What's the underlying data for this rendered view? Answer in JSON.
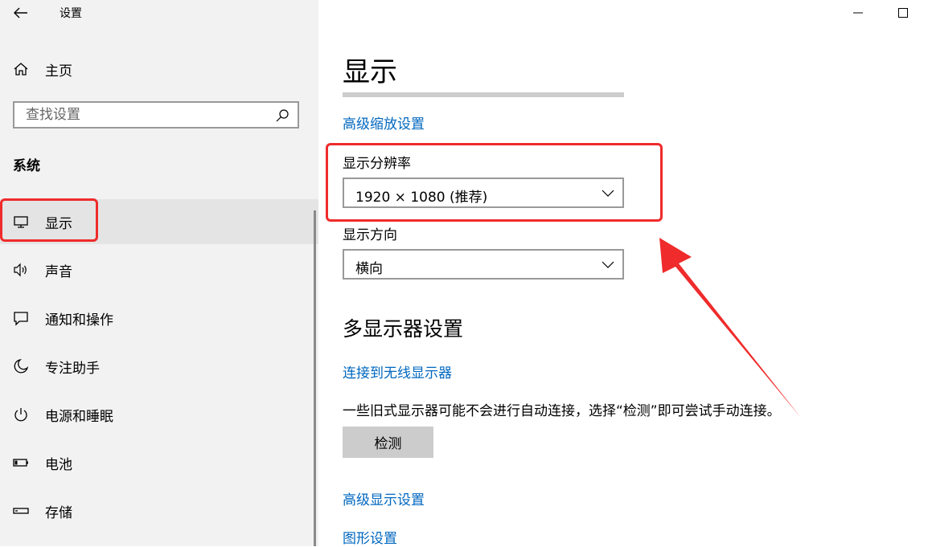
{
  "window": {
    "title": "设置",
    "back_icon": "back-arrow-icon",
    "minimize_icon": "minimize-icon",
    "maximize_icon": "maximize-icon"
  },
  "sidebar": {
    "home_label": "主页",
    "search_placeholder": "查找设置",
    "section_label": "系统",
    "items": [
      {
        "label": "显示",
        "icon": "monitor-icon",
        "selected": true
      },
      {
        "label": "声音",
        "icon": "speaker-icon"
      },
      {
        "label": "通知和操作",
        "icon": "notification-icon"
      },
      {
        "label": "专注助手",
        "icon": "moon-icon"
      },
      {
        "label": "电源和睡眠",
        "icon": "power-icon"
      },
      {
        "label": "电池",
        "icon": "battery-icon"
      },
      {
        "label": "存储",
        "icon": "storage-icon"
      }
    ]
  },
  "main": {
    "title": "显示",
    "progress_fraction": 1.0,
    "advanced_scaling_link": "高级缩放设置",
    "resolution_label": "显示分辨率",
    "resolution_value": "1920 × 1080 (推荐)",
    "orientation_label": "显示方向",
    "orientation_value": "横向",
    "multi_display_heading": "多显示器设置",
    "wireless_link": "连接到无线显示器",
    "detect_description": "一些旧式显示器可能不会进行自动连接，选择“检测”即可尝试手动连接。",
    "detect_button": "检测",
    "advanced_display_link": "高级显示设置",
    "graphics_link": "图形设置"
  },
  "annotation": {
    "color": "#ef2b2b"
  }
}
